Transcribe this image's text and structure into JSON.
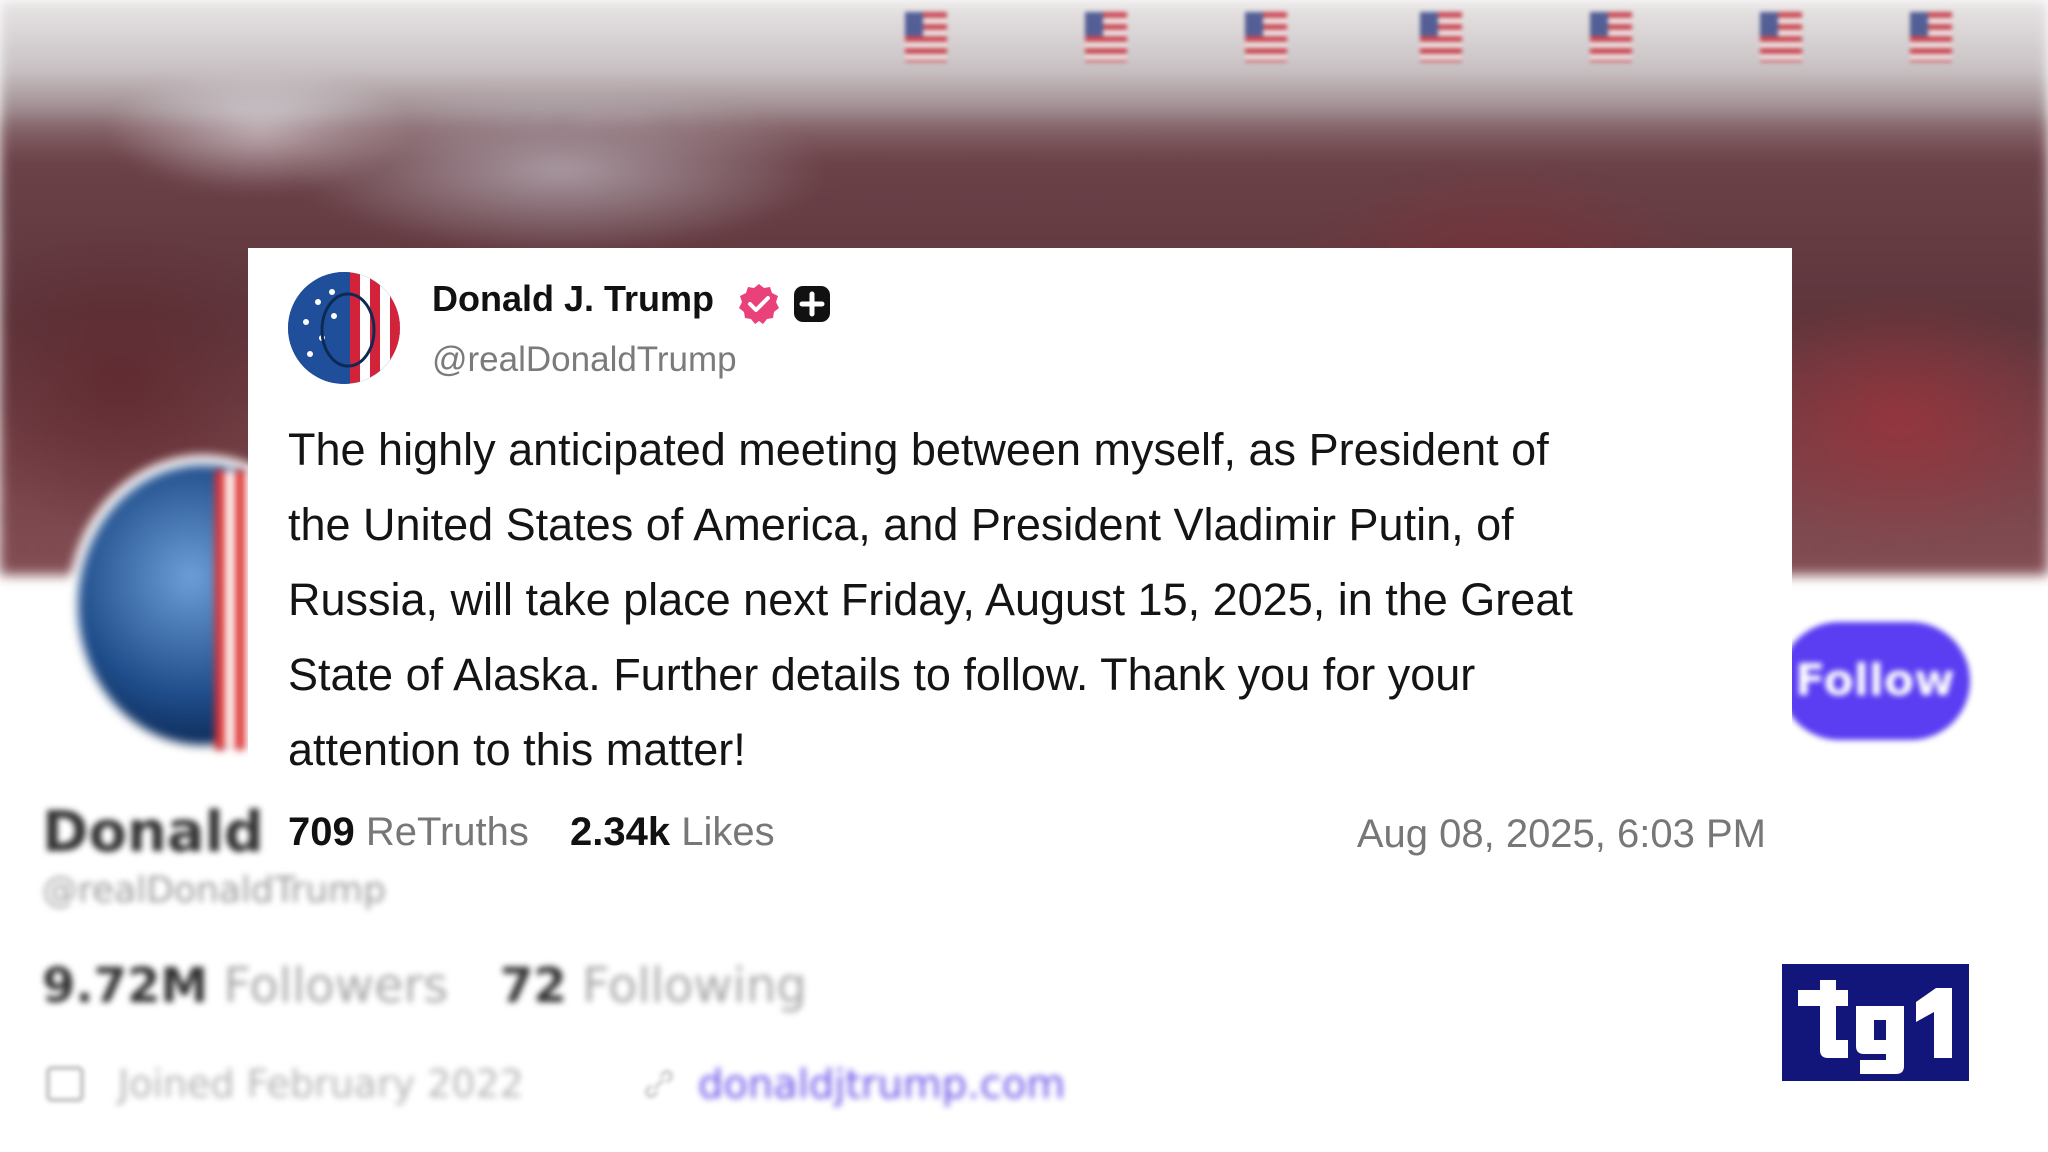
{
  "post": {
    "author_name": "Donald J. Trump",
    "author_handle": "@realDonaldTrump",
    "text_lines": [
      "The highly anticipated meeting between myself, as President of",
      "the United States of America, and President Vladimir Putin, of",
      "Russia, will take place next Friday, August 15, 2025, in the Great",
      "State of Alaska. Further details to follow. Thank you for your",
      "attention to this matter!"
    ],
    "retruths_count": "709",
    "retruths_label": "ReTruths",
    "likes_count": "2.34k",
    "likes_label": "Likes",
    "timestamp": "Aug 08, 2025, 6:03 PM",
    "verified_icon": "verified-badge-icon",
    "plus_icon": "plus-badge-icon"
  },
  "background_profile": {
    "name": "Donald",
    "handle": "@realDonaldTrump",
    "followers_count": "9.72M",
    "followers_label": "Followers",
    "following_count": "72",
    "following_label": "Following",
    "joined": "Joined February 2022",
    "website": "donaldjtrump.com",
    "follow_button_label": "Follow"
  },
  "broadcaster": {
    "logo_text": "tg1"
  },
  "colors": {
    "verified_badge": "#e9417a",
    "follow_button": "#5b3df2",
    "link": "#6b52e8",
    "logo_navy": "#12157a"
  }
}
